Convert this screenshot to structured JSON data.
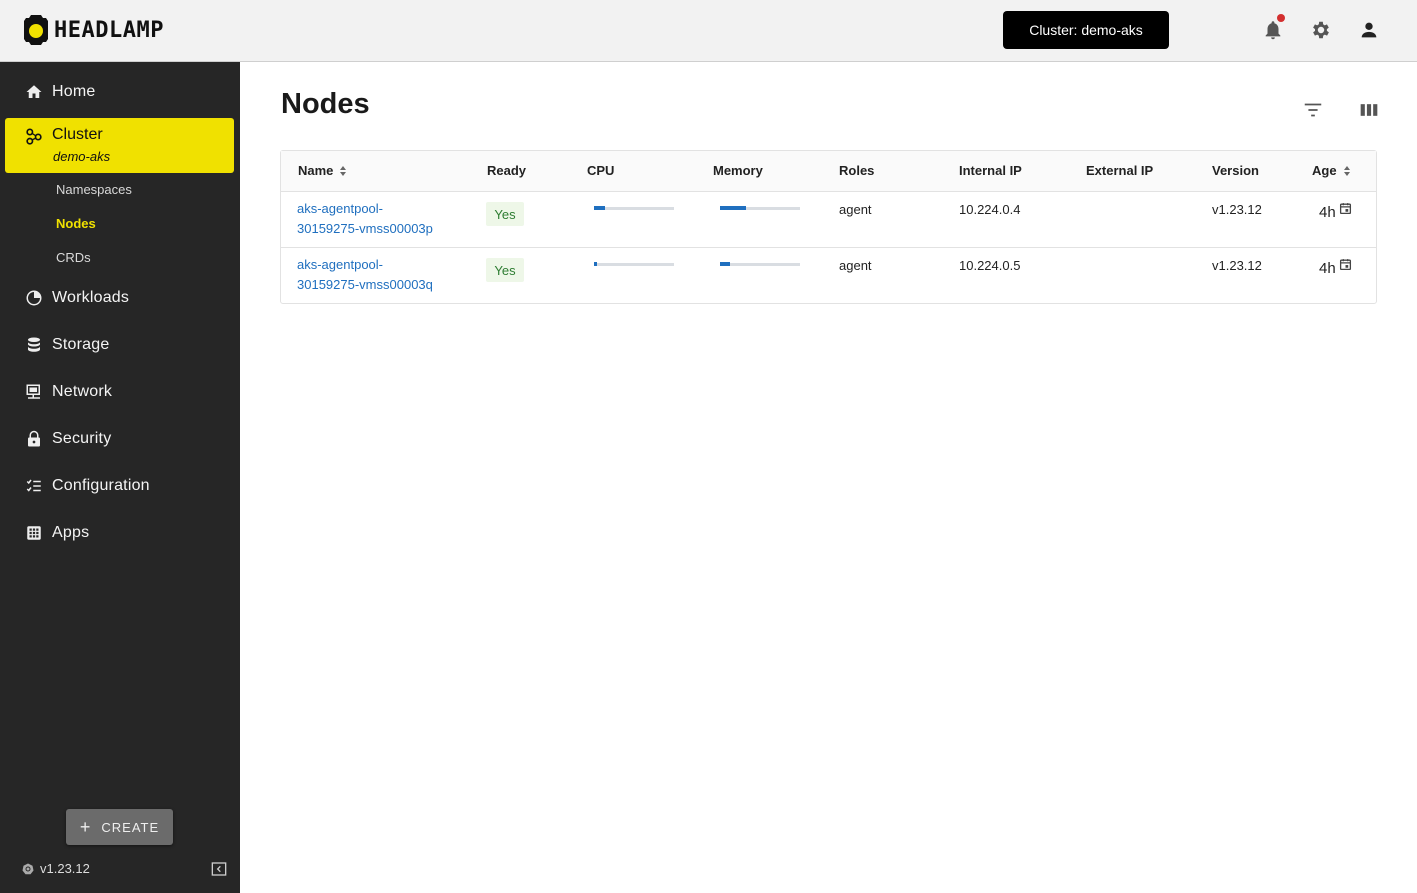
{
  "app": {
    "logo_text": "HEADLAMP"
  },
  "header": {
    "cluster_button": "Cluster: demo-aks",
    "icons": [
      "notifications-icon",
      "settings-icon",
      "user-icon"
    ]
  },
  "sidebar": {
    "items": [
      {
        "label": "Home",
        "icon": "home-icon"
      },
      {
        "label": "Cluster",
        "sub": "demo-aks",
        "icon": "cluster-icon"
      },
      {
        "label": "Workloads",
        "icon": "workloads-icon"
      },
      {
        "label": "Storage",
        "icon": "storage-icon"
      },
      {
        "label": "Network",
        "icon": "network-icon"
      },
      {
        "label": "Security",
        "icon": "lock-icon"
      },
      {
        "label": "Configuration",
        "icon": "configuration-icon"
      },
      {
        "label": "Apps",
        "icon": "apps-icon"
      }
    ],
    "subitems": [
      "Namespaces",
      "Nodes",
      "CRDs"
    ],
    "create_label": "CREATE",
    "version": "v1.23.12"
  },
  "page": {
    "title": "Nodes",
    "columns": [
      "Name",
      "Ready",
      "CPU",
      "Memory",
      "Roles",
      "Internal IP",
      "External IP",
      "Version",
      "Age"
    ],
    "rows": [
      {
        "name_line1": "aks-agentpool-",
        "name_line2": "30159275-vmss00003p",
        "ready": "Yes",
        "cpu_fraction": 0.14,
        "memory_fraction": 0.33,
        "roles": "agent",
        "internal_ip": "10.224.0.4",
        "external_ip": "",
        "version": "v1.23.12",
        "age": "4h"
      },
      {
        "name_line1": "aks-agentpool-",
        "name_line2": "30159275-vmss00003q",
        "ready": "Yes",
        "cpu_fraction": 0.04,
        "memory_fraction": 0.12,
        "roles": "agent",
        "internal_ip": "10.224.0.5",
        "external_ip": "",
        "version": "v1.23.12",
        "age": "4h"
      }
    ]
  },
  "colors": {
    "accent": "#f0e100",
    "sidebar_bg": "#262626",
    "link": "#1f6fbf",
    "ready_badge_bg": "#eef7e8",
    "ready_badge_text": "#2e7d32"
  }
}
